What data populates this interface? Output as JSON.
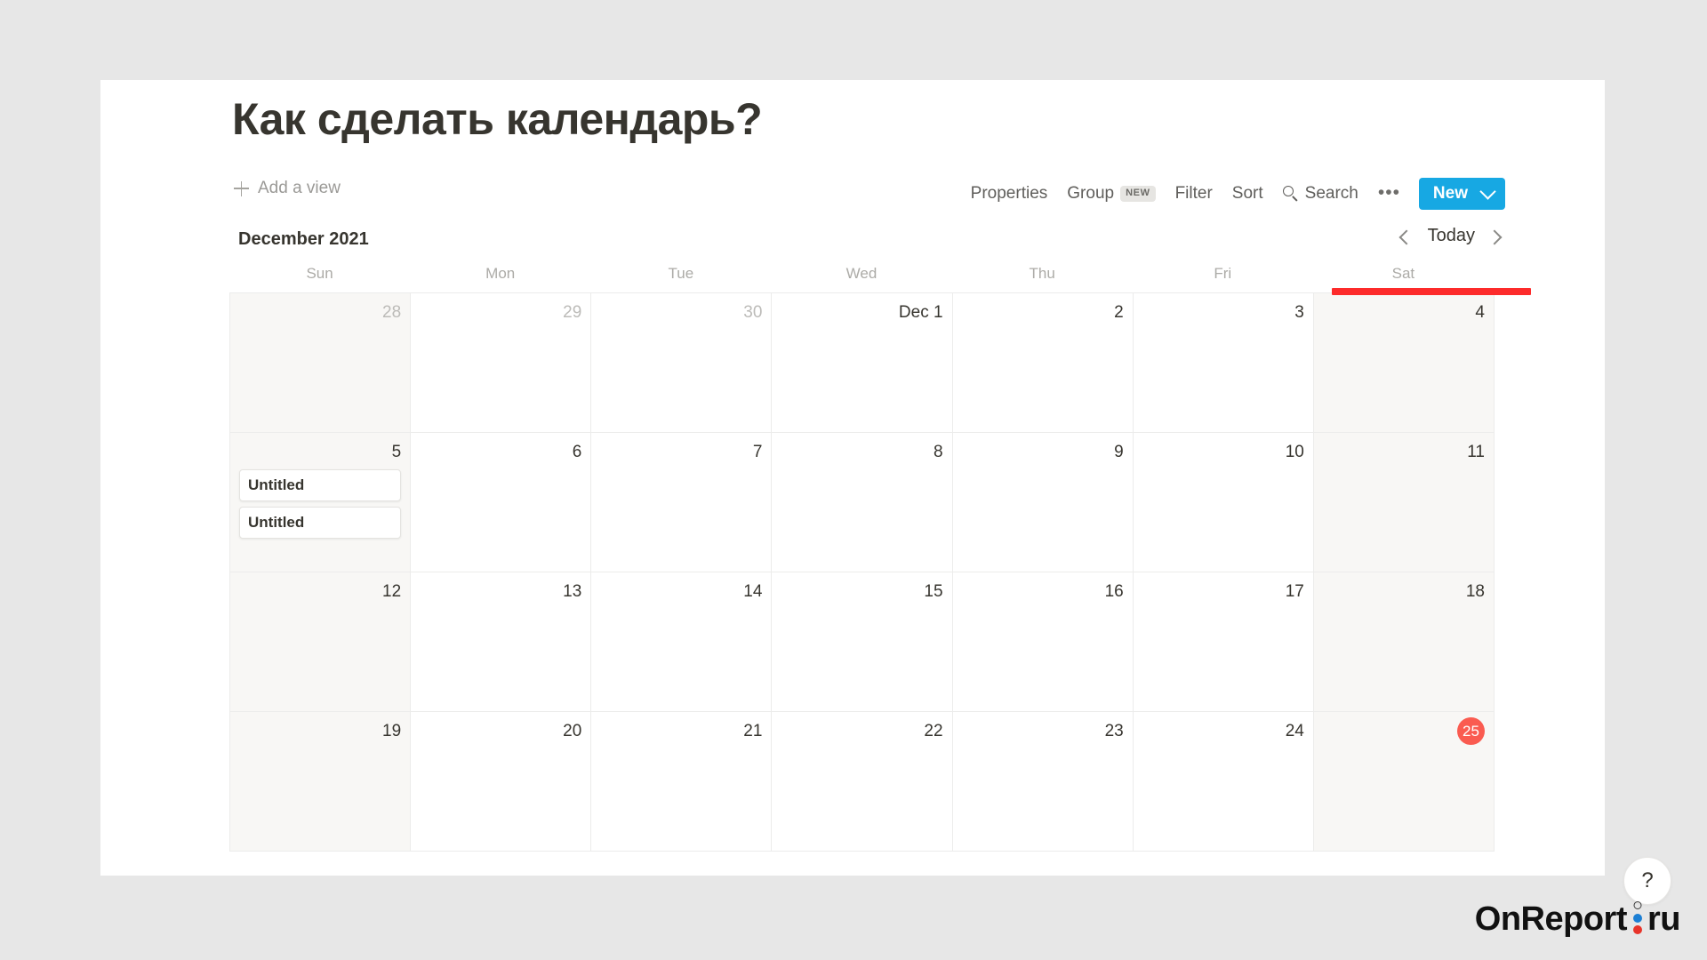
{
  "page": {
    "title": "Как сделать календарь?"
  },
  "toolbar": {
    "add_view_label": "Add a view",
    "add_view_icon": "plus-icon",
    "properties_label": "Properties",
    "group_label": "Group",
    "group_badge": "NEW",
    "filter_label": "Filter",
    "sort_label": "Sort",
    "search_label": "Search",
    "search_icon": "search-icon",
    "more_icon": "ellipsis-icon",
    "more_label": "•••",
    "new_button_label": "New",
    "new_button_chevron": "chevron-down-icon",
    "new_button_color": "#17a8e3"
  },
  "calendar": {
    "month_label": "December 2021",
    "nav": {
      "prev_icon": "chevron-left-icon",
      "today_label": "Today",
      "next_icon": "chevron-right-icon"
    },
    "weekdays": [
      "Sun",
      "Mon",
      "Tue",
      "Wed",
      "Thu",
      "Fri",
      "Sat"
    ],
    "weeks": [
      [
        {
          "num": "28",
          "muted": true,
          "weekend": true,
          "today": false,
          "events": []
        },
        {
          "num": "29",
          "muted": true,
          "weekend": false,
          "today": false,
          "events": []
        },
        {
          "num": "30",
          "muted": true,
          "weekend": false,
          "today": false,
          "events": []
        },
        {
          "num": "Dec 1",
          "muted": false,
          "weekend": false,
          "today": false,
          "events": []
        },
        {
          "num": "2",
          "muted": false,
          "weekend": false,
          "today": false,
          "events": []
        },
        {
          "num": "3",
          "muted": false,
          "weekend": false,
          "today": false,
          "events": []
        },
        {
          "num": "4",
          "muted": false,
          "weekend": true,
          "today": false,
          "events": []
        }
      ],
      [
        {
          "num": "5",
          "muted": false,
          "weekend": true,
          "today": false,
          "events": [
            "Untitled",
            "Untitled"
          ]
        },
        {
          "num": "6",
          "muted": false,
          "weekend": false,
          "today": false,
          "events": []
        },
        {
          "num": "7",
          "muted": false,
          "weekend": false,
          "today": false,
          "events": []
        },
        {
          "num": "8",
          "muted": false,
          "weekend": false,
          "today": false,
          "events": []
        },
        {
          "num": "9",
          "muted": false,
          "weekend": false,
          "today": false,
          "events": []
        },
        {
          "num": "10",
          "muted": false,
          "weekend": false,
          "today": false,
          "events": []
        },
        {
          "num": "11",
          "muted": false,
          "weekend": true,
          "today": false,
          "events": []
        }
      ],
      [
        {
          "num": "12",
          "muted": false,
          "weekend": true,
          "today": false,
          "events": []
        },
        {
          "num": "13",
          "muted": false,
          "weekend": false,
          "today": false,
          "events": []
        },
        {
          "num": "14",
          "muted": false,
          "weekend": false,
          "today": false,
          "events": []
        },
        {
          "num": "15",
          "muted": false,
          "weekend": false,
          "today": false,
          "events": []
        },
        {
          "num": "16",
          "muted": false,
          "weekend": false,
          "today": false,
          "events": []
        },
        {
          "num": "17",
          "muted": false,
          "weekend": false,
          "today": false,
          "events": []
        },
        {
          "num": "18",
          "muted": false,
          "weekend": true,
          "today": false,
          "events": []
        }
      ],
      [
        {
          "num": "19",
          "muted": false,
          "weekend": true,
          "today": false,
          "events": []
        },
        {
          "num": "20",
          "muted": false,
          "weekend": false,
          "today": false,
          "events": []
        },
        {
          "num": "21",
          "muted": false,
          "weekend": false,
          "today": false,
          "events": []
        },
        {
          "num": "22",
          "muted": false,
          "weekend": false,
          "today": false,
          "events": []
        },
        {
          "num": "23",
          "muted": false,
          "weekend": false,
          "today": false,
          "events": []
        },
        {
          "num": "24",
          "muted": false,
          "weekend": false,
          "today": false,
          "events": []
        },
        {
          "num": "25",
          "muted": false,
          "weekend": true,
          "today": true,
          "events": []
        }
      ]
    ],
    "today_color": "#fa5b50"
  },
  "annotation": {
    "color": "#fd2b2b",
    "target_column": "Sat"
  },
  "help": {
    "label": "?",
    "icon": "question-mark-icon"
  },
  "watermark": {
    "text_left": "OnReport",
    "text_right": "ru",
    "dot_blue": "#1c7fd4",
    "dot_red": "#e8342a"
  }
}
